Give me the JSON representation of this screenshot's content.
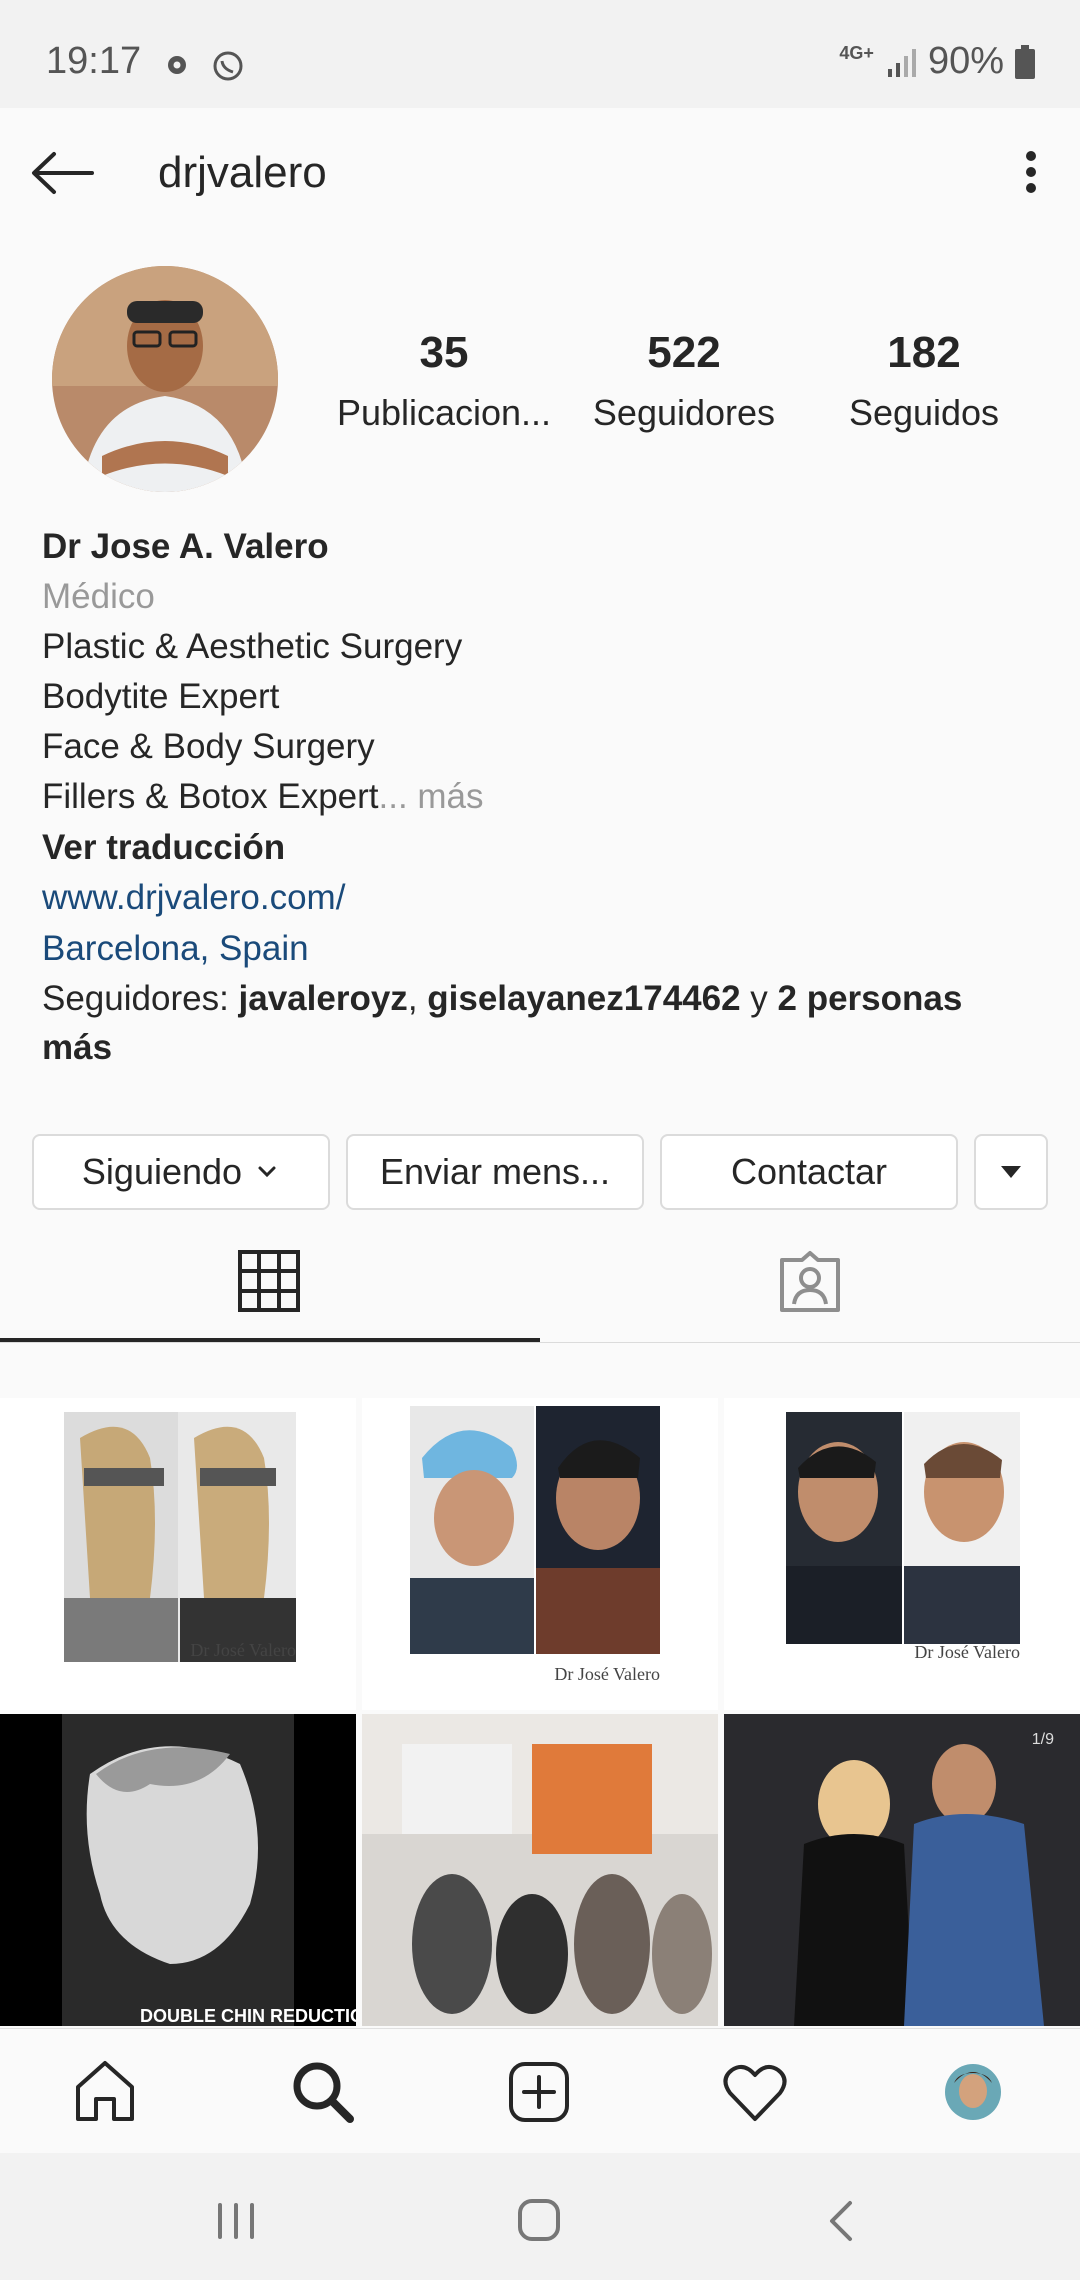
{
  "status_bar": {
    "time": "19:17",
    "network": "4G+",
    "battery": "90%"
  },
  "header": {
    "username": "drjvalero"
  },
  "profile": {
    "stats": [
      {
        "count": "35",
        "label": "Publicacion..."
      },
      {
        "count": "522",
        "label": "Seguidores"
      },
      {
        "count": "182",
        "label": "Seguidos"
      }
    ],
    "name": "Dr Jose A. Valero",
    "category": "Médico",
    "bio_lines": [
      "Plastic & Aesthetic Surgery",
      "Bodytite Expert",
      "Face & Body Surgery",
      "Fillers & Botox Expert"
    ],
    "bio_more": "... más",
    "see_translation": "Ver traducción",
    "website": "www.drjvalero.com/",
    "location": "Barcelona, Spain",
    "followed_by": {
      "prefix": "Seguidores: ",
      "user1": "javaleroyz",
      "sep": ", ",
      "user2": "giselayanez174462",
      "conj": " y ",
      "others": "2 personas más"
    }
  },
  "actions": {
    "following": "Siguiendo",
    "message": "Enviar mens...",
    "contact": "Contactar"
  },
  "grid_captions": {
    "post1": "Dr José Valero",
    "post2": "Dr José Valero",
    "post3": "Dr José Valero",
    "post4": "DOUBLE CHIN REDUCTION",
    "post6_counter": "1/9"
  },
  "icons": {
    "back": "arrow-left-icon",
    "menu": "more-vertical-icon",
    "grid_tab": "grid-icon",
    "tagged_tab": "tagged-person-icon",
    "nav": [
      "home-icon",
      "search-icon",
      "add-post-icon",
      "heart-icon",
      "profile-avatar"
    ]
  },
  "colors": {
    "link": "#1a4a7a",
    "muted": "#999999",
    "text": "#262626",
    "border": "#dbdbdb"
  }
}
